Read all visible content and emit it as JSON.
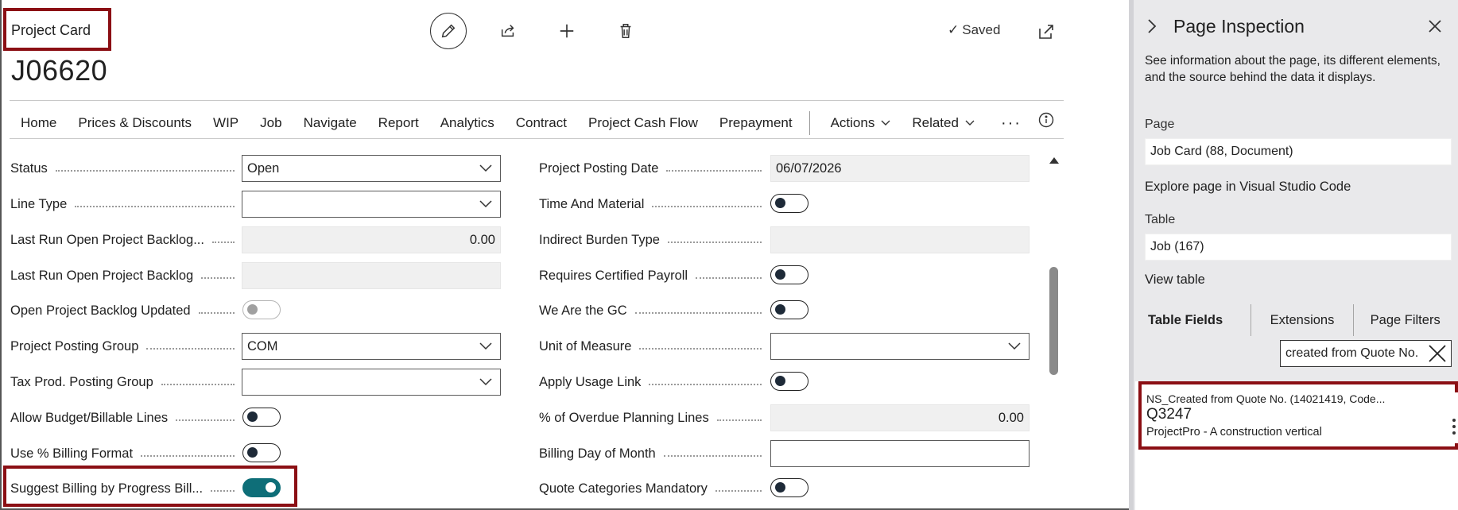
{
  "card": {
    "title": "Project Card",
    "number": "J06620",
    "saved_label": "Saved"
  },
  "toolbar": {
    "edit": "pencil-icon",
    "share": "share-icon",
    "new": "plus-icon",
    "delete": "trash-icon"
  },
  "nav": {
    "items": [
      "Home",
      "Prices & Discounts",
      "WIP",
      "Job",
      "Navigate",
      "Report",
      "Analytics",
      "Contract",
      "Project Cash Flow",
      "Prepayment"
    ],
    "actions": "Actions",
    "related": "Related",
    "more": "···"
  },
  "fields_left": [
    {
      "label": "Status",
      "type": "dropdown",
      "value": "Open"
    },
    {
      "label": "Line Type",
      "type": "dropdown",
      "value": ""
    },
    {
      "label": "Last Run Open Project Backlog...",
      "type": "readonly-number",
      "value": "0.00"
    },
    {
      "label": "Last Run Open Project Backlog",
      "type": "readonly",
      "value": ""
    },
    {
      "label": "Open Project Backlog Updated",
      "type": "toggle",
      "value": false,
      "disabled": true
    },
    {
      "label": "Project Posting Group",
      "type": "dropdown",
      "value": "COM"
    },
    {
      "label": "Tax Prod. Posting Group",
      "type": "dropdown",
      "value": ""
    },
    {
      "label": "Allow Budget/Billable Lines",
      "type": "toggle",
      "value": false
    },
    {
      "label": "Use % Billing Format",
      "type": "toggle",
      "value": false
    },
    {
      "label": "Suggest Billing by Progress Bill...",
      "type": "toggle",
      "value": true
    }
  ],
  "fields_right": [
    {
      "label": "Project Posting Date",
      "type": "readonly",
      "value": "06/07/2026"
    },
    {
      "label": "Time And Material",
      "type": "toggle",
      "value": false
    },
    {
      "label": "Indirect Burden Type",
      "type": "readonly",
      "value": ""
    },
    {
      "label": "Requires Certified Payroll",
      "type": "toggle",
      "value": false
    },
    {
      "label": "We Are the GC",
      "type": "toggle",
      "value": false
    },
    {
      "label": "Unit of Measure",
      "type": "dropdown",
      "value": ""
    },
    {
      "label": "Apply Usage Link",
      "type": "toggle",
      "value": false
    },
    {
      "label": "% of Overdue Planning Lines",
      "type": "readonly-number",
      "value": "0.00"
    },
    {
      "label": "Billing Day of Month",
      "type": "input",
      "value": ""
    },
    {
      "label": "Quote Categories Mandatory",
      "type": "toggle",
      "value": false
    }
  ],
  "inspection": {
    "title": "Page Inspection",
    "description": "See information about the page, its different elements, and the source behind the data it displays.",
    "page_label": "Page",
    "page_value": "Job Card (88, Document)",
    "explore_link": "Explore page in Visual Studio Code",
    "table_label": "Table",
    "table_value": "Job (167)",
    "view_table_link": "View table",
    "tabs": [
      "Table Fields",
      "Extensions",
      "Page Filters"
    ],
    "filter_value": "created from Quote No.",
    "result": {
      "field_name": "NS_Created from Quote No. (14021419, Code...",
      "field_value": "Q3247",
      "source": "ProjectPro - A construction vertical"
    }
  },
  "colors": {
    "highlight": "#8b0f14",
    "toggle_on": "#0e6e78",
    "panel_bg": "#e9e9eb"
  }
}
